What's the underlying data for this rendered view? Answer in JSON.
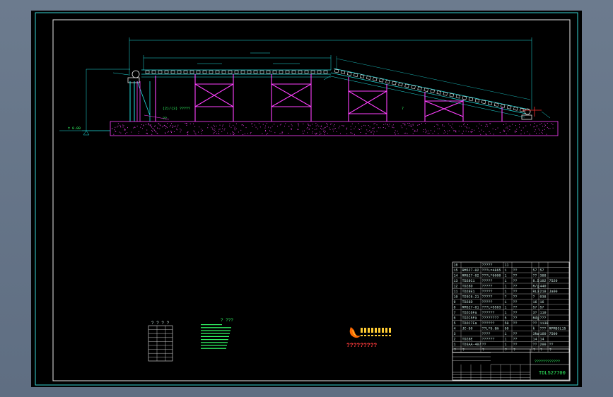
{
  "drawing": {
    "ground_label": "± 0.00",
    "node_mark": "7",
    "callout_upper": "(2)/(3) ?????",
    "callout_lower": "??",
    "small_table_title": "? ? ? ?",
    "notes_title": "? ???",
    "logo_text": "?????????",
    "drawing_number": "TDL527700"
  },
  "bom": {
    "rows": [
      {
        "no": "16",
        "code": "",
        "name": "?????",
        "qty": "11",
        "mat": "",
        "w1": "",
        "w2": "",
        "note": ""
      },
      {
        "no": "15",
        "code": "RM527-02",
        "name": "???L=4865",
        "qty": "1",
        "mat": "??",
        "w1": "57",
        "w2": "57",
        "note": ""
      },
      {
        "no": "14",
        "code": "RM527-02",
        "name": "???L=6000",
        "qty": "1",
        "mat": "??",
        "w1": "??",
        "w2": "388",
        "note": ""
      },
      {
        "no": "13",
        "code": "TD28C1",
        "name": "?????",
        "qty": "1",
        "mat": "??",
        "w1": "8.5",
        "w2": "102",
        "note": "7520"
      },
      {
        "no": "12",
        "code": "TD28D",
        "name": "?????",
        "qty": "1",
        "mat": "??",
        "w1": "R/g",
        "w2": "440",
        "note": ""
      },
      {
        "no": "11",
        "code": "TD28E1",
        "name": "?????",
        "qty": "1",
        "mat": "??",
        "w1": "RL3",
        "w2": "218",
        "note": "Ja00"
      },
      {
        "no": "10",
        "code": "TD3C6-21",
        "name": "?????",
        "qty": "?",
        "mat": "??",
        "w1": "?",
        "w2": "038",
        "note": ""
      },
      {
        "no": "9",
        "code": "TD28D",
        "name": "?????",
        "qty": "1",
        "mat": "??",
        "w1": "16",
        "w2": "16",
        "note": ""
      },
      {
        "no": "8",
        "code": "RM527-01",
        "name": "???L=5563",
        "qty": "1",
        "mat": "??",
        "w1": "57",
        "w2": "57",
        "note": ""
      },
      {
        "no": "7",
        "code": "TD2C6Fa",
        "name": "??????",
        "qty": "1",
        "mat": "??",
        "w1": "3?",
        "w2": "110",
        "note": ""
      },
      {
        "no": "6",
        "code": "TD2C5Fa",
        "name": "????????",
        "qty": "5",
        "mat": "??",
        "w1": "Bdg",
        "w2": "???",
        "note": ""
      },
      {
        "no": "5",
        "code": "TD2C7Fa",
        "name": "??????",
        "qty": "50",
        "mat": "??",
        "w1": "??",
        "w2": "1130",
        "note": ""
      },
      {
        "no": "4",
        "code": "JC-50",
        "name": "??L=5.8m",
        "qty": "50",
        "mat": "",
        "w1": "k",
        "w2": "???",
        "note": "RPMB3L15"
      },
      {
        "no": "3",
        "code": "",
        "name": "????",
        "qty": "1",
        "mat": "??",
        "w1": "3kW",
        "w2": "160",
        "note": "7500"
      },
      {
        "no": "2",
        "code": "TD28E",
        "name": "??????",
        "qty": "1",
        "mat": "??",
        "w1": "14",
        "w2": "14",
        "note": ""
      },
      {
        "no": "1",
        "code": "TD3AA-407",
        "name": "??",
        "qty": "1",
        "mat": "??",
        "w1": "??",
        "w2": "200",
        "note": "??"
      }
    ],
    "header": [
      "?",
      "?",
      "?",
      "?",
      "?",
      "?",
      "?",
      "?",
      "?"
    ]
  }
}
